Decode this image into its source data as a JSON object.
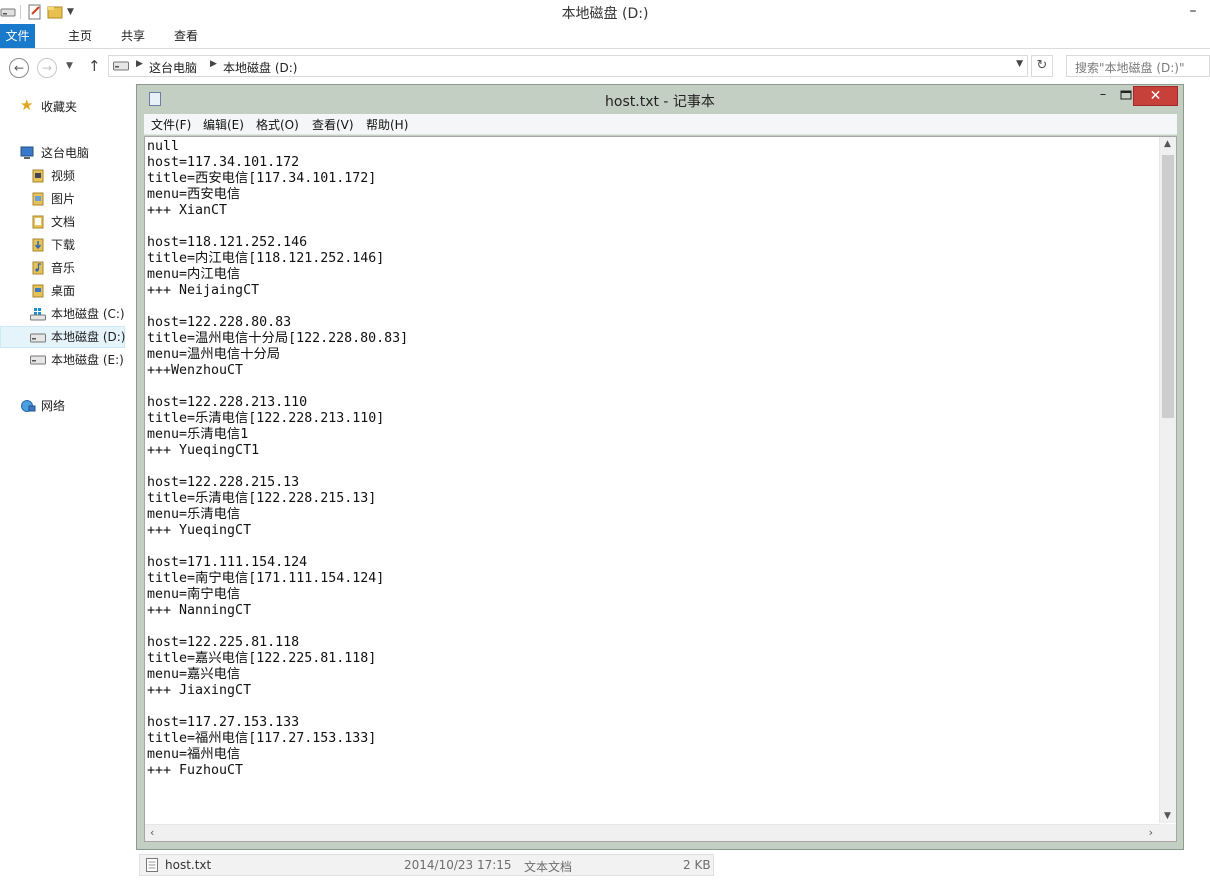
{
  "explorer": {
    "title": "本地磁盘 (D:)",
    "minimize_glyph": "–",
    "ribbon_tabs": [
      "文件",
      "主页",
      "共享",
      "查看"
    ],
    "breadcrumb": [
      "这台电脑",
      "本地磁盘 (D:)"
    ],
    "search_placeholder": "搜索\"本地磁盘 (D:)\"",
    "nav": [
      {
        "label": "收藏夹",
        "icon": "star-icon"
      },
      {
        "label": "这台电脑",
        "icon": "computer-icon"
      },
      {
        "label": "视频",
        "icon": "video-folder-icon"
      },
      {
        "label": "图片",
        "icon": "pictures-folder-icon"
      },
      {
        "label": "文档",
        "icon": "documents-folder-icon"
      },
      {
        "label": "下载",
        "icon": "downloads-folder-icon"
      },
      {
        "label": "音乐",
        "icon": "music-folder-icon"
      },
      {
        "label": "桌面",
        "icon": "desktop-folder-icon"
      },
      {
        "label": "本地磁盘 (C:)",
        "icon": "windows-drive-icon"
      },
      {
        "label": "本地磁盘 (D:)",
        "icon": "drive-icon",
        "selected": true
      },
      {
        "label": "本地磁盘 (E:)",
        "icon": "drive-icon"
      },
      {
        "label": "网络",
        "icon": "network-icon"
      }
    ],
    "file_row": {
      "name": "host.txt",
      "modified": "2014/10/23 17:15",
      "type": "文本文档",
      "size": "2 KB"
    }
  },
  "notepad": {
    "title": "host.txt - 记事本",
    "close_glyph": "✕",
    "min_glyph": "–",
    "menus": [
      "文件(F)",
      "编辑(E)",
      "格式(O)",
      "查看(V)",
      "帮助(H)"
    ],
    "content": "null\nhost=117.34.101.172\ntitle=西安电信[117.34.101.172]\nmenu=西安电信\n+++ XianCT\n\nhost=118.121.252.146\ntitle=内江电信[118.121.252.146]\nmenu=内江电信\n+++ NeijaingCT\n\nhost=122.228.80.83\ntitle=温州电信十分局[122.228.80.83]\nmenu=温州电信十分局\n+++WenzhouCT\n\nhost=122.228.213.110\ntitle=乐清电信[122.228.213.110]\nmenu=乐清电信1\n+++ YueqingCT1\n\nhost=122.228.215.13\ntitle=乐清电信[122.228.215.13]\nmenu=乐清电信\n+++ YueqingCT\n\nhost=171.111.154.124\ntitle=南宁电信[171.111.154.124]\nmenu=南宁电信\n+++ NanningCT\n\nhost=122.225.81.118\ntitle=嘉兴电信[122.225.81.118]\nmenu=嘉兴电信\n+++ JiaxingCT\n\nhost=117.27.153.133\ntitle=福州电信[117.27.153.133]\nmenu=福州电信\n+++ FuzhouCT"
  },
  "colors": {
    "file_tab": "#1979ca",
    "close_button": "#c7403a",
    "notepad_frame": "#c4cfc4"
  }
}
